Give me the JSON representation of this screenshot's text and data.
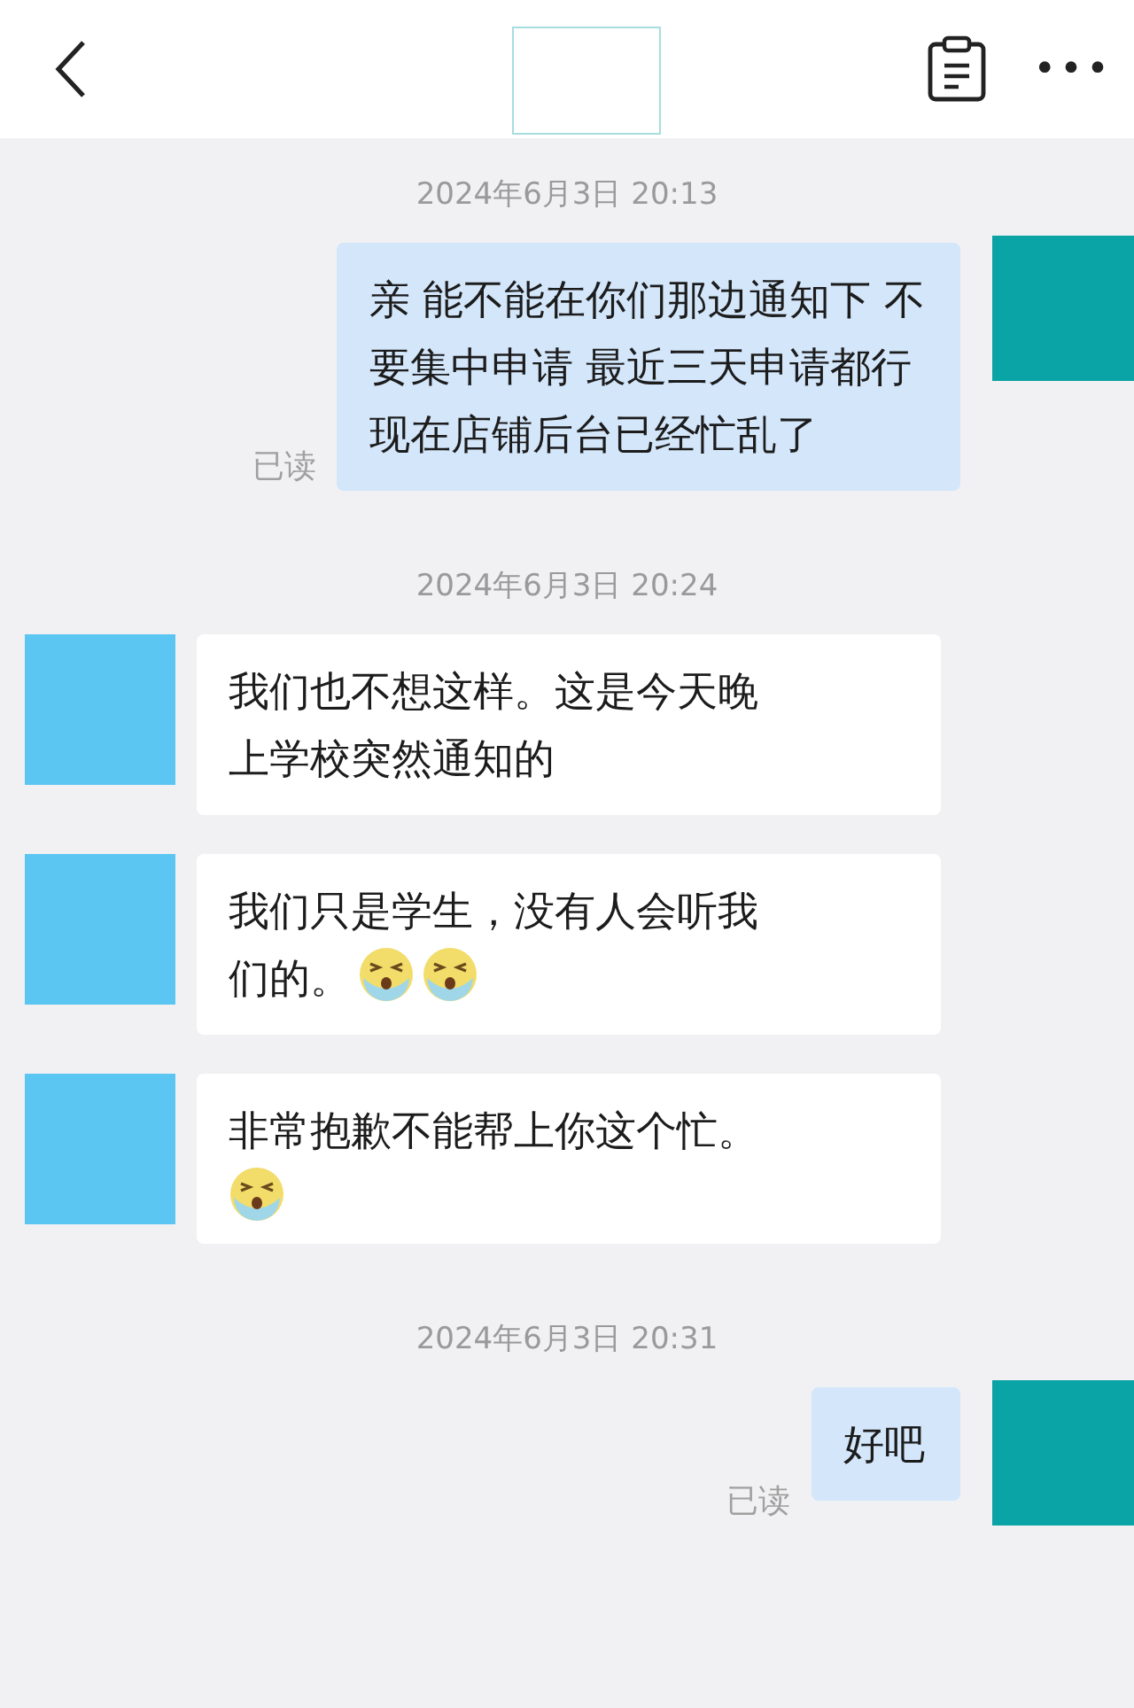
{
  "header": {
    "menu": "•••"
  },
  "messages": [
    {
      "kind": "time",
      "text": "2024年6月3日 20:13"
    },
    {
      "kind": "sent",
      "lines": [
        "亲  能不能在你们那边通知下 不",
        "要集中申请  最近三天申请都行",
        "现在店铺后台已经忙乱了"
      ],
      "read": "已读"
    },
    {
      "kind": "time",
      "text": "2024年6月3日 20:24"
    },
    {
      "kind": "received",
      "lines": [
        "我们也不想这样。这是今天晚",
        "上学校突然通知的"
      ]
    },
    {
      "kind": "received",
      "lines": [
        "我们只是学生，没有人会听我",
        "们的。"
      ],
      "emojis": [
        {
          "kind": "crying"
        },
        {
          "kind": "crying"
        }
      ]
    },
    {
      "kind": "received",
      "lines": [
        "非常抱歉不能帮上你这个忙。"
      ],
      "emoji_line": [
        {
          "kind": "crying"
        }
      ]
    },
    {
      "kind": "time",
      "text": "2024年6月3日 20:31"
    },
    {
      "kind": "sent",
      "lines": [
        "好吧"
      ],
      "read": "已读"
    }
  ]
}
